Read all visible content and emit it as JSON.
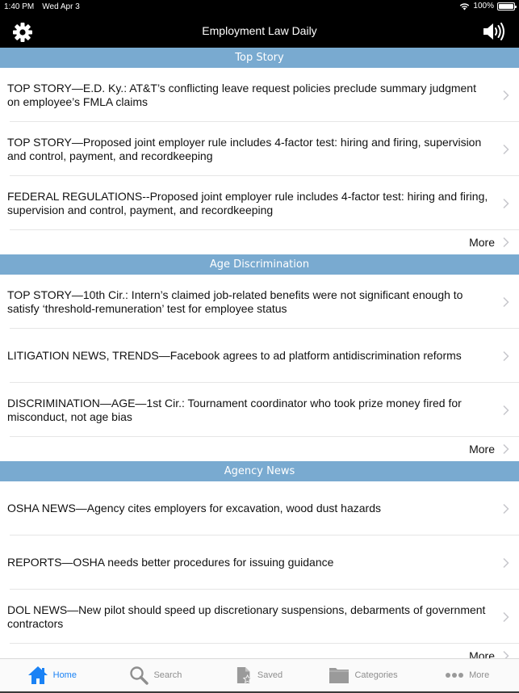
{
  "status_bar": {
    "time": "1:40 PM",
    "date": "Wed Apr 3",
    "battery": "100%",
    "icons": [
      "wifi-icon",
      "battery-icon"
    ]
  },
  "nav": {
    "title": "Employment Law Daily",
    "left_icon": "gear-icon",
    "right_icon": "speaker-icon"
  },
  "colors": {
    "section_header": "#79aad0",
    "tab_active": "#1a82f5",
    "tab_inactive": "#8e8e8e",
    "nav_background": "#000000"
  },
  "sections": [
    {
      "title": "Top Story",
      "articles": [
        "TOP STORY—E.D. Ky.: AT&T’s conflicting leave request policies preclude summary judgment on employee’s FMLA claims",
        "TOP STORY—Proposed joint employer rule includes 4-factor test: hiring and firing, supervision and control, payment, and recordkeeping",
        "FEDERAL REGULATIONS--Proposed joint employer rule includes 4-factor test: hiring and firing, supervision and control, payment, and recordkeeping"
      ],
      "more_label": "More"
    },
    {
      "title": "Age Discrimination",
      "articles": [
        "TOP STORY—10th Cir.: Intern’s claimed job-related benefits were not significant enough to satisfy ‘threshold-remuneration’ test for employee status",
        "LITIGATION NEWS, TRENDS—Facebook agrees to ad platform antidiscrimination reforms",
        "DISCRIMINATION—AGE—1st Cir.: Tournament coordinator who took prize money fired for misconduct, not age bias"
      ],
      "more_label": "More"
    },
    {
      "title": "Agency News",
      "articles": [
        "OSHA NEWS—Agency cites employers for excavation, wood dust hazards",
        "REPORTS—OSHA needs better procedures for issuing guidance",
        "DOL NEWS—New pilot should speed up discretionary suspensions, debarments of government contractors"
      ],
      "more_label": "More"
    }
  ],
  "tabs": [
    {
      "label": "Home",
      "icon": "home-icon",
      "active": true
    },
    {
      "label": "Search",
      "icon": "search-icon",
      "active": false
    },
    {
      "label": "Saved",
      "icon": "saved-document-icon",
      "active": false
    },
    {
      "label": "Categories",
      "icon": "folder-icon",
      "active": false
    },
    {
      "label": "More",
      "icon": "ellipsis-icon",
      "active": false
    }
  ]
}
